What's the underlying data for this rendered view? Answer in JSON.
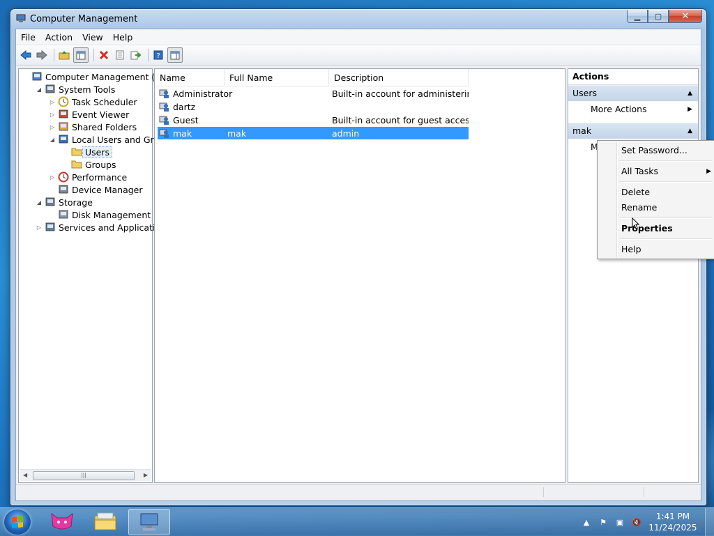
{
  "window": {
    "title": "Computer Management",
    "min": "▁",
    "max": "▢",
    "close": "✕"
  },
  "menubar": [
    "File",
    "Action",
    "View",
    "Help"
  ],
  "tree": {
    "items": [
      {
        "label": "Computer Management (Local",
        "level": 0,
        "twisty": "",
        "icon": "computer-management-icon"
      },
      {
        "label": "System Tools",
        "level": 1,
        "twisty": "◢",
        "icon": "system-tools-icon"
      },
      {
        "label": "Task Scheduler",
        "level": 2,
        "twisty": "▷",
        "icon": "clock-icon"
      },
      {
        "label": "Event Viewer",
        "level": 2,
        "twisty": "▷",
        "icon": "event-viewer-icon"
      },
      {
        "label": "Shared Folders",
        "level": 2,
        "twisty": "▷",
        "icon": "shared-folders-icon"
      },
      {
        "label": "Local Users and Groups",
        "level": 2,
        "twisty": "◢",
        "icon": "users-groups-icon"
      },
      {
        "label": "Users",
        "level": 3,
        "twisty": "",
        "icon": "folder-icon"
      },
      {
        "label": "Groups",
        "level": 3,
        "twisty": "",
        "icon": "folder-icon"
      },
      {
        "label": "Performance",
        "level": 2,
        "twisty": "▷",
        "icon": "performance-icon"
      },
      {
        "label": "Device Manager",
        "level": 2,
        "twisty": "",
        "icon": "device-manager-icon"
      },
      {
        "label": "Storage",
        "level": 1,
        "twisty": "◢",
        "icon": "storage-icon"
      },
      {
        "label": "Disk Management",
        "level": 2,
        "twisty": "",
        "icon": "disk-icon"
      },
      {
        "label": "Services and Applications",
        "level": 1,
        "twisty": "▷",
        "icon": "services-icon"
      }
    ],
    "scroll_thumb": "|||"
  },
  "list": {
    "columns": [
      "Name",
      "Full Name",
      "Description"
    ],
    "rows": [
      {
        "name": "Administrator",
        "full_name": "",
        "description": "Built-in account for administering..."
      },
      {
        "name": "dartz",
        "full_name": "",
        "description": ""
      },
      {
        "name": "Guest",
        "full_name": "",
        "description": "Built-in account for guest access t..."
      },
      {
        "name": "mak",
        "full_name": "mak",
        "description": "admin"
      }
    ]
  },
  "actions": {
    "header": "Actions",
    "section1": "Users",
    "more_actions": "More Actions",
    "section2": "mak",
    "partial_item": "M"
  },
  "context_menu": {
    "set_password": "Set Password...",
    "all_tasks": "All Tasks",
    "delete": "Delete",
    "rename": "Rename",
    "properties": "Properties",
    "help": "Help"
  },
  "taskbar": {
    "time": "1:41 PM",
    "date": "11/24/2025"
  },
  "colors": {
    "selection": "#3399ff",
    "accent": "#1e62b5"
  }
}
